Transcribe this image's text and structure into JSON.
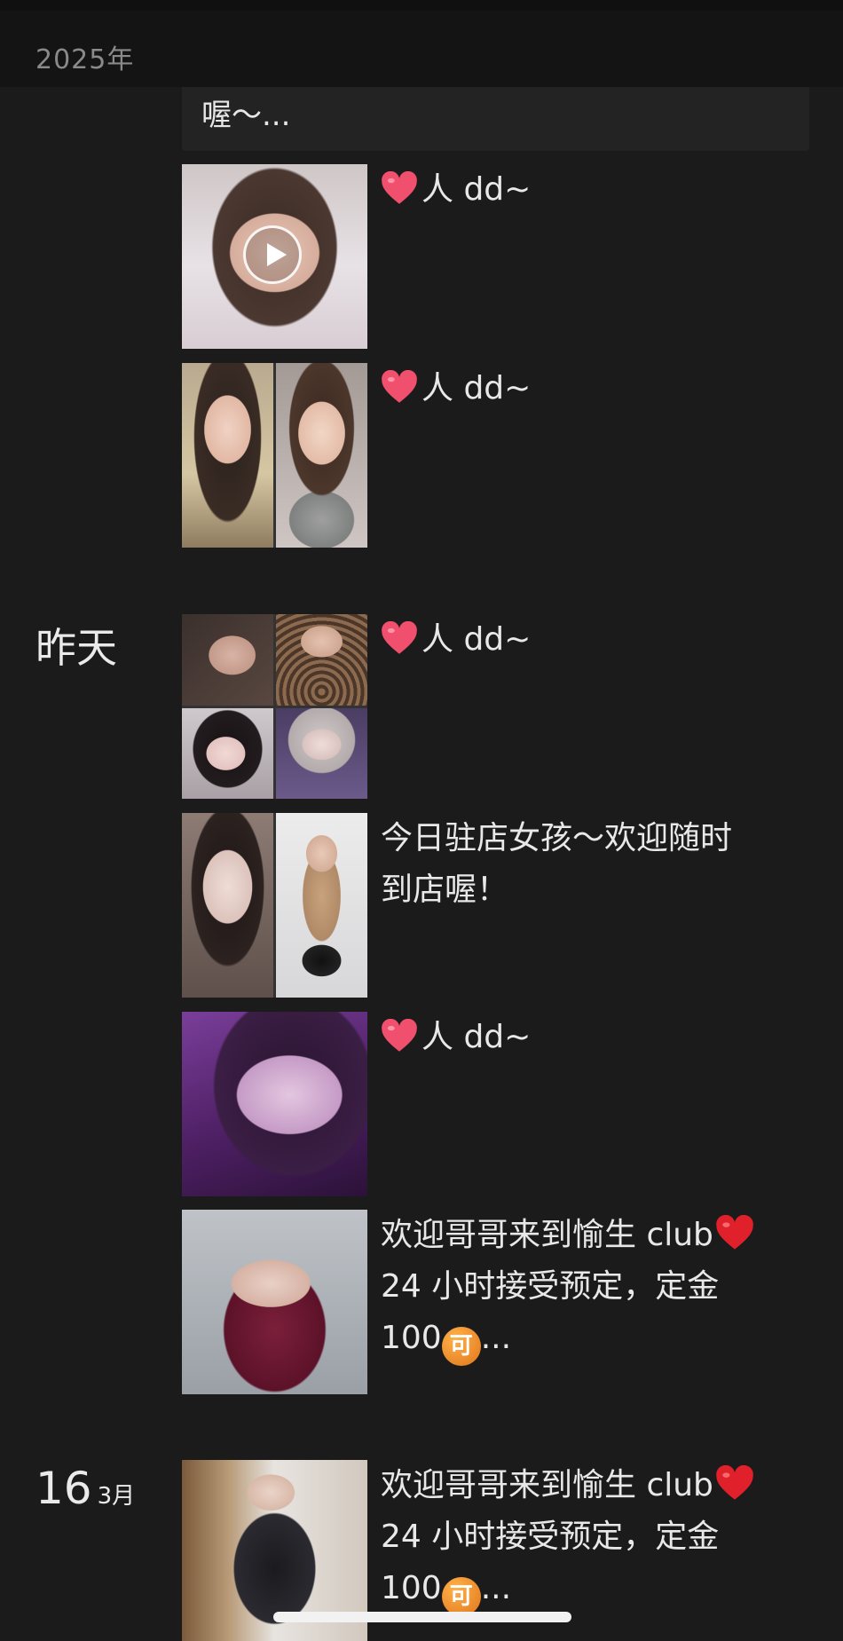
{
  "header": {
    "year": "2025年"
  },
  "previous_post": {
    "caption": "喔～..."
  },
  "days": [
    {
      "label": "昨天"
    },
    {
      "day": "16",
      "month": "3月"
    }
  ],
  "posts": [
    {
      "text": "人 dd~"
    },
    {
      "text": "人 dd~"
    },
    {
      "text": "人 dd~"
    },
    {
      "text": "今日驻店女孩～欢迎随时\n到店喔！"
    },
    {
      "text": "人 dd~"
    },
    {
      "line1": "欢迎哥哥来到愉生 club",
      "line2": "24 小时接受预定，定金",
      "line3_pre": "100",
      "coin": "可",
      "line3_post": "..."
    },
    {
      "line1": "欢迎哥哥来到愉生 club",
      "line2": "24 小时接受预定，定金",
      "line3_pre": "100",
      "coin": "可",
      "line3_post": "..."
    }
  ],
  "icons": {
    "play": "play-icon",
    "heart": "heart-icon",
    "red_heart": "red-heart-icon",
    "coin": "coin-icon"
  },
  "colors": {
    "background": "#1b1b1b",
    "heart_pink": "#f0506e",
    "heart_red": "#e0202a",
    "coin_orange": "#e9851f"
  }
}
